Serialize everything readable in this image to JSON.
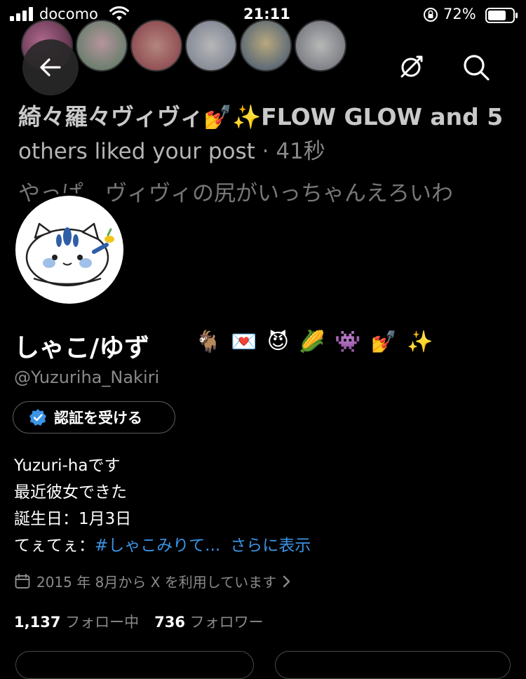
{
  "status_bar": {
    "carrier": "docomo",
    "time": "21:11",
    "battery_pct": "72%",
    "icons": [
      "signal-icon",
      "wifi-icon",
      "orientation-lock-icon",
      "battery-icon"
    ]
  },
  "header": {
    "liker_avatars": [
      "avatar-1",
      "avatar-2",
      "avatar-3",
      "avatar-4",
      "avatar-5",
      "avatar-6"
    ],
    "notification": {
      "line1": "綺々羅々ヴィヴィ💅✨FLOW GLOW and 5",
      "line2_main": "others liked your post",
      "line2_time": " · 41秒",
      "line3": "やっぱ、ヴィヴィの尻がいっちゃんえろいわ"
    },
    "icons": [
      "back-arrow-icon",
      "unfollow-icon",
      "search-icon"
    ]
  },
  "profile": {
    "display_name": "しゃこ/ゆず",
    "name_emoji": [
      "🐐",
      "💌",
      "😈",
      "🌽",
      "👾",
      "💅",
      "✨"
    ],
    "handle": "@Yuzuriha_Nakiri",
    "verify_label": "認証を受ける",
    "bio": {
      "line1": "Yuzuri-haです",
      "line2": "最近彼女できた",
      "line3": "誕生日：1月3日",
      "line4_prefix": "てぇてぇ：",
      "line4_hashtag": "#しゃこみりて...",
      "show_more": "さらに表示"
    },
    "joined": "2015 年 8月から X を利用しています",
    "following_count": "1,137",
    "following_label": "フォロー中",
    "followers_count": "736",
    "followers_label": "フォロワー"
  },
  "colors": {
    "background": "#000000",
    "accent": "#3b94e6",
    "muted": "#8a8a8a"
  }
}
